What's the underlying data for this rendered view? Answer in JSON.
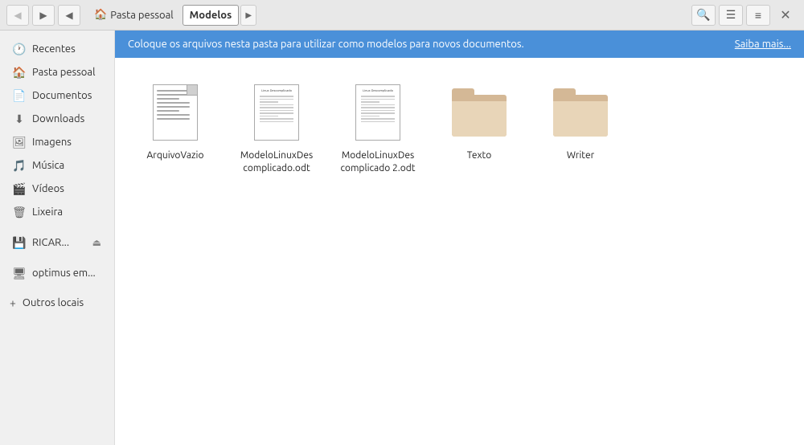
{
  "titlebar": {
    "back_label": "◀",
    "forward_label": "▶",
    "up_label": "◀",
    "path": [
      {
        "label": "🏠 Pasta pessoal",
        "active": false
      },
      {
        "label": "Modelos",
        "active": true
      },
      {
        "label": "▶",
        "is_arrow": true
      }
    ],
    "search_tooltip": "Pesquisar",
    "view_toggle_tooltip": "Alternar modo de exibição",
    "menu_tooltip": "Menu",
    "close_label": "✕"
  },
  "sidebar": {
    "items": [
      {
        "id": "recentes",
        "label": "Recentes",
        "icon": "🕐"
      },
      {
        "id": "pasta-pessoal",
        "label": "Pasta pessoal",
        "icon": "🏠"
      },
      {
        "id": "documentos",
        "label": "Documentos",
        "icon": "📄"
      },
      {
        "id": "downloads",
        "label": "Downloads",
        "icon": "⬇"
      },
      {
        "id": "imagens",
        "label": "Imagens",
        "icon": "🖼"
      },
      {
        "id": "musica",
        "label": "Música",
        "icon": "🎵"
      },
      {
        "id": "videos",
        "label": "Vídeos",
        "icon": "🎬"
      },
      {
        "id": "lixeira",
        "label": "Lixeira",
        "icon": "🗑"
      },
      {
        "id": "ricar",
        "label": "RICAR...",
        "icon": "💾",
        "eject": true
      },
      {
        "id": "optimus",
        "label": "optimus em...",
        "icon": "🖥"
      },
      {
        "id": "outros",
        "label": "Outros locais",
        "icon": "+"
      }
    ]
  },
  "banner": {
    "text": "Coloque os arquivos nesta pasta para utilizar como modelos para novos documentos.",
    "link": "Saiba mais..."
  },
  "files": [
    {
      "id": "arquivo-vazio",
      "name": "ArquivoVazio",
      "type": "doc"
    },
    {
      "id": "modelo1",
      "name": "ModeloLinuxDescomplicado.odt",
      "type": "template"
    },
    {
      "id": "modelo2",
      "name": "ModeloLinuxDescomplicado 2.odt",
      "type": "template"
    },
    {
      "id": "texto",
      "name": "Texto",
      "type": "folder"
    },
    {
      "id": "writer",
      "name": "Writer",
      "type": "folder"
    }
  ]
}
